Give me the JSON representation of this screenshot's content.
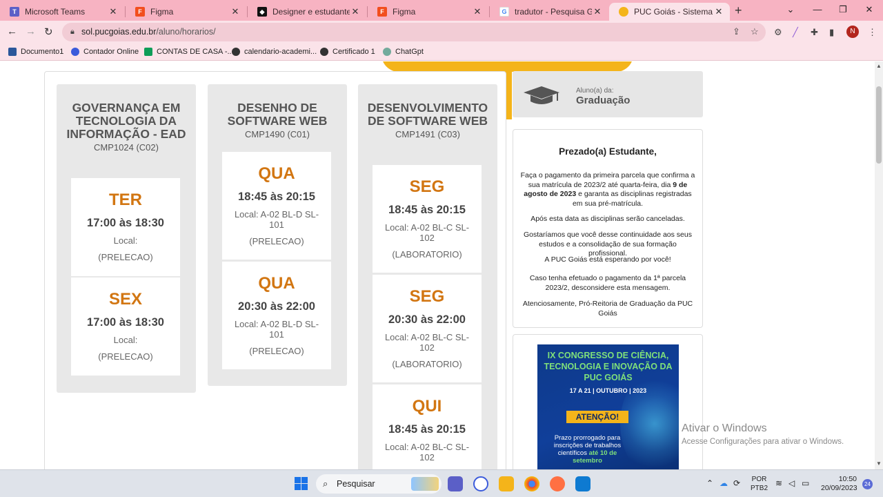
{
  "browser": {
    "tabs": [
      {
        "label": "Microsoft Teams",
        "icon": "teams-icon",
        "color": "#5b5fc7",
        "active": false
      },
      {
        "label": "Figma",
        "icon": "figma-icon",
        "color": "#f24e1e",
        "active": false
      },
      {
        "label": "Designer e estudante?. Saib",
        "icon": "site-icon",
        "color": "#111111",
        "active": false
      },
      {
        "label": "Figma",
        "icon": "figma-icon",
        "color": "#f24e1e",
        "active": false
      },
      {
        "label": "tradutor - Pesquisa Google",
        "icon": "google-icon",
        "color": "#4285f4",
        "active": false
      },
      {
        "label": "PUC Goiás - Sistema Aluno",
        "icon": "puc-icon",
        "color": "#f4b41a",
        "active": true
      }
    ],
    "new_tab": "+",
    "url_host": "sol.pucgoias.edu.br",
    "url_path": "/aluno/horarios/",
    "profile_initial": "N",
    "bookmarks": [
      {
        "label": "Documento1",
        "color": "#2b579a"
      },
      {
        "label": "Contador Online",
        "color": "#3b5bdb"
      },
      {
        "label": "CONTAS DE CASA -...",
        "color": "#0f9d58"
      },
      {
        "label": "calendario-academi...",
        "color": "#333333"
      },
      {
        "label": "Certificado 1",
        "color": "#333333"
      },
      {
        "label": "ChatGpt",
        "color": "#74aa9c"
      }
    ]
  },
  "schedule": [
    {
      "name": "GOVERNANÇA EM TECNOLOGIA DA INFORMAÇÃO - EAD",
      "code": "CMP1024 (C02)",
      "slots": [
        {
          "day": "TER",
          "time": "17:00 às 18:30",
          "location": "Local:",
          "type": "(PRELECAO)"
        },
        {
          "day": "SEX",
          "time": "17:00 às 18:30",
          "location": "Local:",
          "type": "(PRELECAO)"
        }
      ]
    },
    {
      "name": "DESENHO DE SOFTWARE WEB",
      "code": "CMP1490 (C01)",
      "slots": [
        {
          "day": "QUA",
          "time": "18:45 às 20:15",
          "location": "Local: A-02 BL-D SL-101",
          "type": "(PRELECAO)"
        },
        {
          "day": "QUA",
          "time": "20:30 às 22:00",
          "location": "Local: A-02 BL-D SL-101",
          "type": "(PRELECAO)"
        }
      ]
    },
    {
      "name": "DESENVOLVIMENTO DE SOFTWARE WEB",
      "code": "CMP1491 (C03)",
      "slots": [
        {
          "day": "SEG",
          "time": "18:45 às 20:15",
          "location": "Local: A-02 BL-C SL-102",
          "type": "(LABORATORIO)"
        },
        {
          "day": "SEG",
          "time": "20:30 às 22:00",
          "location": "Local: A-02 BL-C SL-102",
          "type": "(LABORATORIO)"
        },
        {
          "day": "QUI",
          "time": "18:45 às 20:15",
          "location": "Local: A-02 BL-C SL-102",
          "type": ""
        }
      ]
    }
  ],
  "sidebar": {
    "student_label": "Aluno(a) da:",
    "student_level": "Graduação",
    "message": {
      "title": "Prezado(a) Estudante,",
      "p1_a": "Faça o pagamento da primeira parcela que confirma a sua matrícula de 2023/2 até quarta-feira, dia ",
      "p1_b": "9 de agosto de 2023",
      "p1_c": " e garanta as disciplinas registradas em sua pré-matrícula.",
      "p2": "Após esta data as disciplinas serão canceladas.",
      "p3": "Gostaríamos que você desse continuidade aos seus estudos e a consolidação de sua formação profissional.",
      "p4": "A PUC Goiás está esperando por você!",
      "p5": "Caso tenha efetuado o pagamento da 1ª parcela 2023/2, desconsidere esta mensagem.",
      "p6": "Atenciosamente, Pró-Reitoria de Graduação da PUC Goiás"
    },
    "poster": {
      "title": "IX CONGRESSO DE CIÊNCIA, TECNOLOGIA E INOVAÇÃO DA PUC GOIÁS",
      "dates": "17 A 21 | OUTUBRO | 2023",
      "attention": "ATENÇÃO!",
      "text": "Prazo prorrogado para inscrições de trabalhos científicos",
      "deadline": "até 10 de setembro"
    }
  },
  "watermark": {
    "title": "Ativar o Windows",
    "subtitle": "Acesse Configurações para ativar o Windows."
  },
  "taskbar": {
    "search_label": "Pesquisar",
    "lang_line1": "POR",
    "lang_line2": "PTB2",
    "time": "10:50",
    "date": "20/09/2023",
    "notifications": "24"
  }
}
